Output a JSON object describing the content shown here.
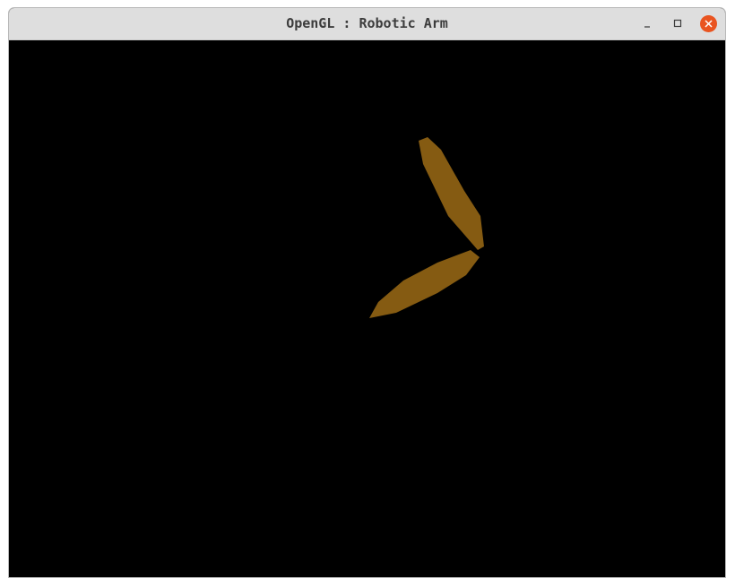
{
  "window": {
    "title": "OpenGL : Robotic Arm",
    "controls": {
      "minimize_icon": "minimize-icon",
      "maximize_icon": "maximize-icon",
      "close_icon": "close-icon"
    }
  },
  "scene": {
    "background_color": "#000000",
    "arm_color": "#855b12"
  }
}
